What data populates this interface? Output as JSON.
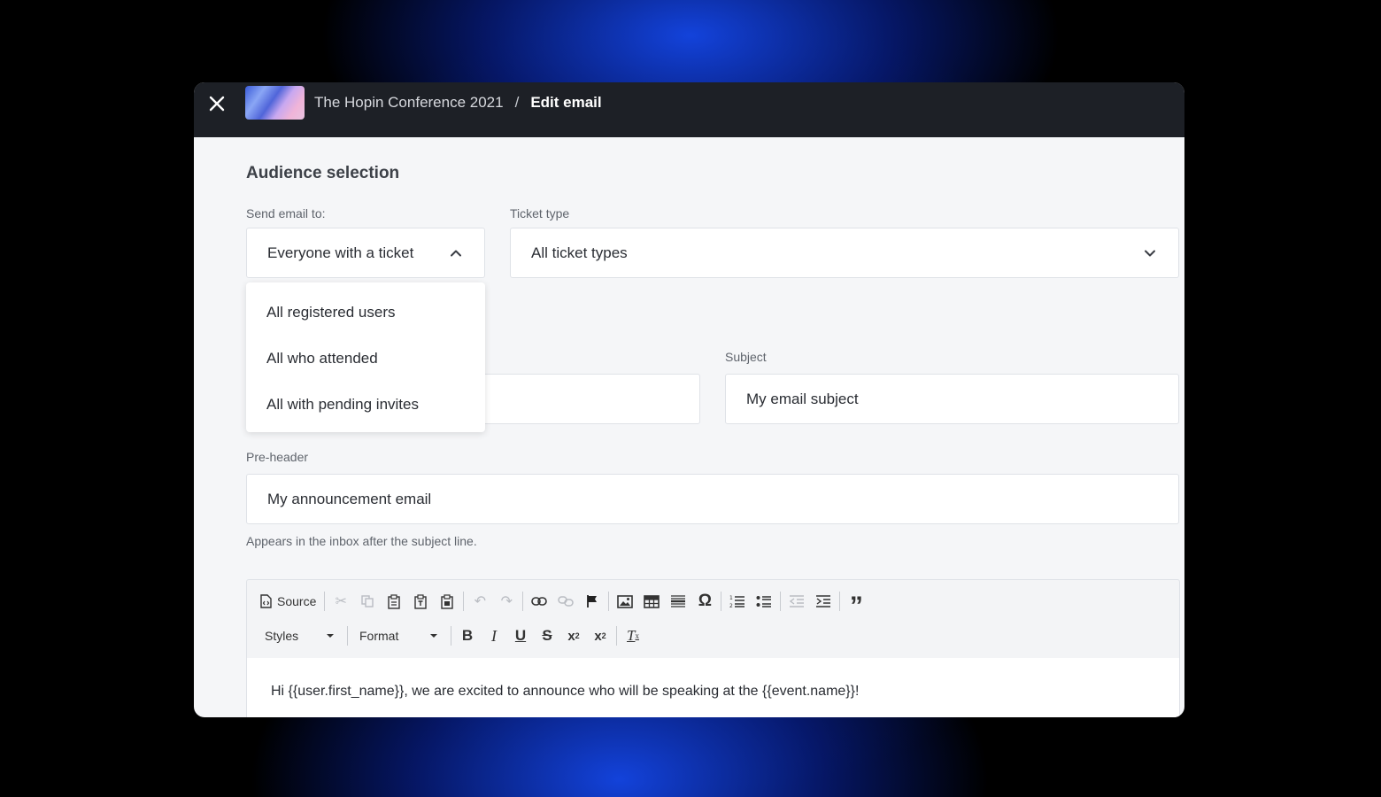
{
  "header": {
    "event_title": "The Hopin Conference 2021",
    "separator": "/",
    "current_page": "Edit email"
  },
  "audience": {
    "section_title": "Audience selection",
    "send_to_label": "Send email to:",
    "send_to_value": "Everyone with a ticket",
    "ticket_type_label": "Ticket type",
    "ticket_type_value": "All ticket types",
    "options": [
      "All registered users",
      "All who attended",
      "All with pending invites"
    ]
  },
  "email": {
    "subject_label": "Subject",
    "subject_value": "My email subject",
    "preheader_label": "Pre-header",
    "preheader_value": "My announcement email",
    "preheader_helper": "Appears in the inbox after the subject line."
  },
  "editor": {
    "source_label": "Source",
    "styles_label": "Styles",
    "format_label": "Format",
    "body_text": "Hi {{user.first_name}}, we are excited to announce who will be speaking at the {{event.name}}!"
  },
  "icons": {
    "close": "close-icon",
    "chevron_up": "chevron-up-icon",
    "chevron_down": "chevron-down-icon"
  }
}
